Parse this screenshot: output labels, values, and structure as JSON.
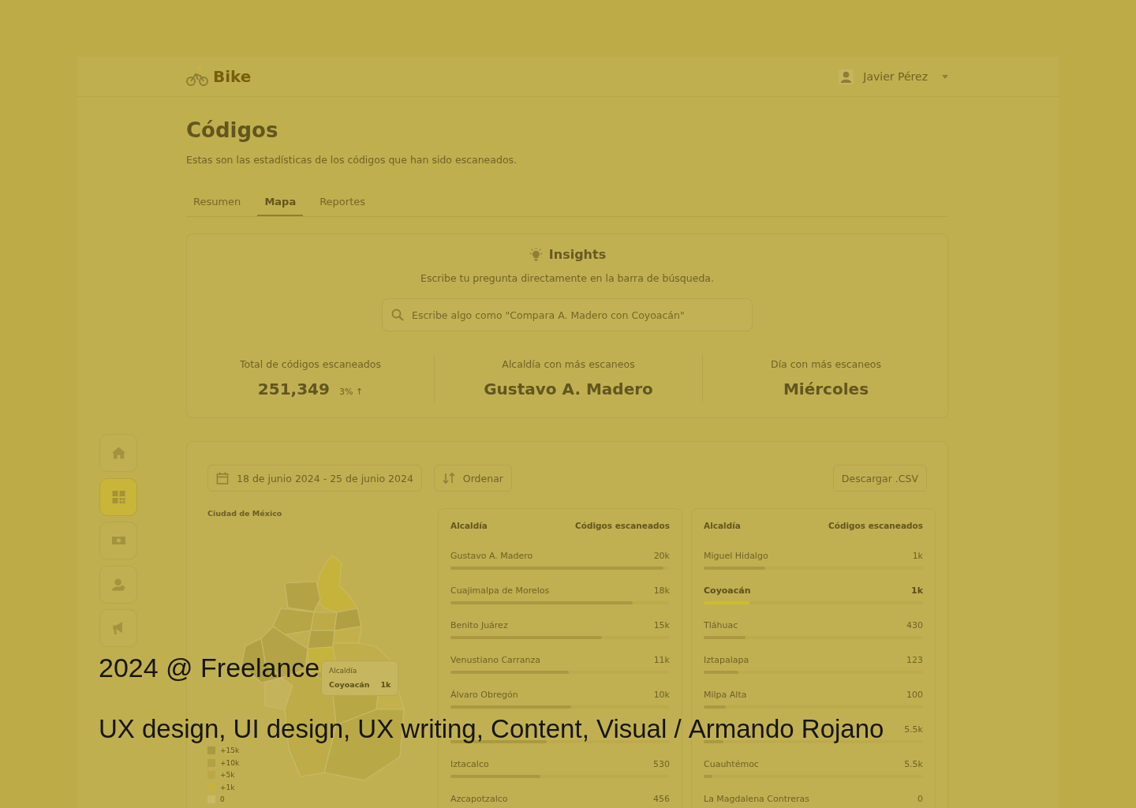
{
  "header": {
    "logo": "Bike",
    "user_name": "Javier Pérez"
  },
  "sidebar": {
    "items": [
      {
        "selected": false
      },
      {
        "selected": true
      },
      {
        "selected": false
      },
      {
        "selected": false
      },
      {
        "selected": false
      }
    ]
  },
  "page": {
    "title": "Códigos",
    "subtitle": "Estas son las estadísticas de los códigos que han sido escaneados."
  },
  "tabs": [
    {
      "label": "Resumen",
      "selected": false
    },
    {
      "label": "Mapa",
      "selected": true
    },
    {
      "label": "Reportes",
      "selected": false
    }
  ],
  "insights": {
    "title": "Insights",
    "subtitle": "Escribe tu pregunta directamente en la barra de búsqueda.",
    "search": {
      "placeholder": "Escribe algo como \"Compara A. Madero con Coyoacán\""
    },
    "stats": [
      {
        "label": "Total de códigos escaneados",
        "value": "251,349",
        "change": "3% ↑"
      },
      {
        "label": "Alcaldía con más escaneos",
        "value": "Gustavo A. Madero"
      },
      {
        "label": "Día con más escaneos",
        "value": "Miércoles"
      }
    ]
  },
  "toolbar": {
    "date_range": "18 de junio 2024 - 25 de junio 2024",
    "sort": "Ordenar",
    "download": "Descargar .CSV"
  },
  "map": {
    "title": "Ciudad de México",
    "tooltip": {
      "label": "Alcaldía",
      "name": "Coyoacán",
      "value": "1k"
    },
    "legend": [
      {
        "label": "+15k",
        "color": "#a99a3f"
      },
      {
        "label": "+10k",
        "color": "#b1a243"
      },
      {
        "label": "+5k",
        "color": "#b9a845"
      },
      {
        "label": "+1k",
        "color": "#c6b33c"
      },
      {
        "label": "0",
        "color": "#c9ba66"
      }
    ]
  },
  "tables": [
    {
      "columns": [
        "Alcaldía",
        "Códigos escaneados"
      ],
      "rows": [
        {
          "name": "Gustavo A. Madero",
          "value": "20k",
          "level": 0.97,
          "selected": false
        },
        {
          "name": "Cuajimalpa de Morelos",
          "value": "18k",
          "level": 0.83,
          "selected": false
        },
        {
          "name": "Benito Juárez",
          "value": "15k",
          "level": 0.69,
          "selected": false
        },
        {
          "name": "Venustiano Carranza",
          "value": "11k",
          "level": 0.54,
          "selected": false
        },
        {
          "name": "Álvaro Obregón",
          "value": "10k",
          "level": 0.55,
          "selected": false
        },
        {
          "level": 0.44,
          "selected": false
        },
        {
          "name": "Iztacalco",
          "value": "530",
          "level": 0.41,
          "selected": false
        },
        {
          "name": "Azcapotzalco",
          "value": "456",
          "selected": false
        }
      ]
    },
    {
      "columns": [
        "Alcaldía",
        "Códigos escaneados"
      ],
      "rows": [
        {
          "name": "Miguel Hidalgo",
          "value": "1k",
          "level": 0.28,
          "selected": false
        },
        {
          "name": "Coyoacán",
          "value": "1k",
          "level": 0.21,
          "selected": true
        },
        {
          "name": "Tláhuac",
          "value": "430",
          "level": 0.19,
          "selected": false
        },
        {
          "name": "Iztapalapa",
          "value": "123",
          "level": 0.16,
          "selected": false
        },
        {
          "name": "Milpa Alta",
          "value": "100",
          "level": 0.1,
          "selected": false
        },
        {
          "value": "5.5k",
          "level": 0.09,
          "selected": false
        },
        {
          "name": "Cuauhtémoc",
          "value": "5.5k",
          "level": 0.04,
          "selected": false
        },
        {
          "name": "La Magdalena Contreras",
          "value": "0",
          "selected": false
        }
      ]
    }
  ],
  "caption": {
    "year_client": "2024 @ Freelance",
    "roles": "UX design, UI design, UX writing, Content, Visual /",
    "author": "Armando Rojano"
  }
}
